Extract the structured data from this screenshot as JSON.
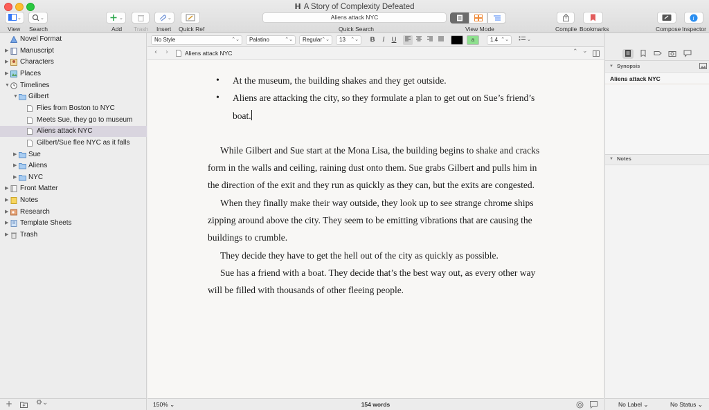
{
  "window": {
    "title": "A Story of Complexity Defeated",
    "doc_glyph": "𝗛"
  },
  "toolbar": {
    "view_label": "View",
    "search_label": "Search",
    "add_label": "Add",
    "trash_label": "Trash",
    "insert_label": "Insert",
    "quickref_label": "Quick Ref",
    "quick_search_value": "Aliens attack NYC",
    "quick_search_label": "Quick Search",
    "view_mode_label": "View Mode",
    "compile_label": "Compile",
    "bookmarks_label": "Bookmarks",
    "compose_label": "Compose",
    "inspector_label": "Inspector",
    "colors": {
      "add_green": "#2fa84f",
      "bookmark_red": "#e25c5c",
      "inspector_blue": "#2a8ef0",
      "corkboard_orange": "#ef8b3a"
    }
  },
  "binder": {
    "items": [
      {
        "label": "Novel Format",
        "icon": "novel-format-icon",
        "depth": 0,
        "disclosure": ""
      },
      {
        "label": "Manuscript",
        "icon": "manuscript-icon",
        "depth": 0,
        "disclosure": "▶"
      },
      {
        "label": "Characters",
        "icon": "characters-icon",
        "depth": 0,
        "disclosure": "▶"
      },
      {
        "label": "Places",
        "icon": "places-icon",
        "depth": 0,
        "disclosure": "▶"
      },
      {
        "label": "Timelines",
        "icon": "clock-icon",
        "depth": 0,
        "disclosure": "▼"
      },
      {
        "label": "Gilbert",
        "icon": "folder-icon",
        "depth": 1,
        "disclosure": "▼"
      },
      {
        "label": "Flies from Boston to NYC",
        "icon": "document-icon",
        "depth": 2,
        "disclosure": ""
      },
      {
        "label": "Meets Sue, they go to museum",
        "icon": "document-icon",
        "depth": 2,
        "disclosure": ""
      },
      {
        "label": "Aliens attack NYC",
        "icon": "document-icon",
        "depth": 2,
        "disclosure": "",
        "selected": true
      },
      {
        "label": "Gilbert/Sue flee NYC as it falls",
        "icon": "document-icon",
        "depth": 2,
        "disclosure": ""
      },
      {
        "label": "Sue",
        "icon": "folder-icon",
        "depth": 1,
        "disclosure": "▶"
      },
      {
        "label": "Aliens",
        "icon": "folder-icon",
        "depth": 1,
        "disclosure": "▶"
      },
      {
        "label": "NYC",
        "icon": "folder-icon",
        "depth": 1,
        "disclosure": "▶"
      },
      {
        "label": "Front Matter",
        "icon": "front-matter-icon",
        "depth": 0,
        "disclosure": "▶"
      },
      {
        "label": "Notes",
        "icon": "notes-icon",
        "depth": 0,
        "disclosure": "▶"
      },
      {
        "label": "Research",
        "icon": "research-icon",
        "depth": 0,
        "disclosure": "▶"
      },
      {
        "label": "Template Sheets",
        "icon": "template-sheets-icon",
        "depth": 0,
        "disclosure": "▶"
      },
      {
        "label": "Trash",
        "icon": "trash-icon",
        "depth": 0,
        "disclosure": "▶"
      }
    ]
  },
  "format_bar": {
    "style": "No Style",
    "font": "Palatino",
    "weight": "Regular",
    "size": "13",
    "bold": "B",
    "italic": "I",
    "underline": "U",
    "highlight": "a",
    "line_spacing": "1.4",
    "text_color": "#000000",
    "highlight_color": "#8ee08e"
  },
  "editor": {
    "header_title": "Aliens attack NYC",
    "bullets": [
      "At the museum, the building shakes and they get outside.",
      "Aliens are attacking the city, so they formulate a plan to get out on Sue’s friend’s boat."
    ],
    "paragraphs": [
      "While Gilbert and Sue start at the Mona Lisa, the building begins to shake and cracks form in the walls and ceiling, raining dust onto them. Sue grabs Gilbert and pulls him in the direction of the exit and they run as quickly as they can, but the exits are congested.",
      "When they finally make their way outside, they look up to see strange chrome ships zipping around above the city. They seem to be emitting vibrations that are causing the buildings to crumble.",
      "They decide they have to get the hell out of the city as quickly as possible.",
      "Sue has a friend with a boat. They decide that’s the best way out, as every other way will be filled with thousands of other fleeing people."
    ],
    "zoom": "150%",
    "word_count": "154 words"
  },
  "inspector": {
    "synopsis_header": "Synopsis",
    "synopsis_title": "Aliens attack NYC",
    "notes_header": "Notes",
    "label_value": "No Label",
    "status_value": "No Status"
  }
}
